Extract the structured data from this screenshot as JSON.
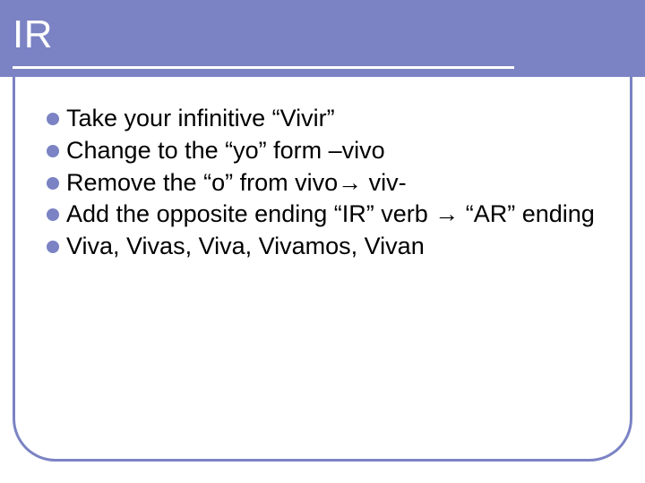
{
  "slide": {
    "title": "IR",
    "bullets": [
      "Take your infinitive “Vivir”",
      "Change to the “yo” form –vivo",
      "Remove the “o” from vivo→ viv-",
      "Add the opposite ending “IR” verb → “AR” ending",
      "Viva, Vivas, Viva, Vivamos, Vivan"
    ]
  }
}
